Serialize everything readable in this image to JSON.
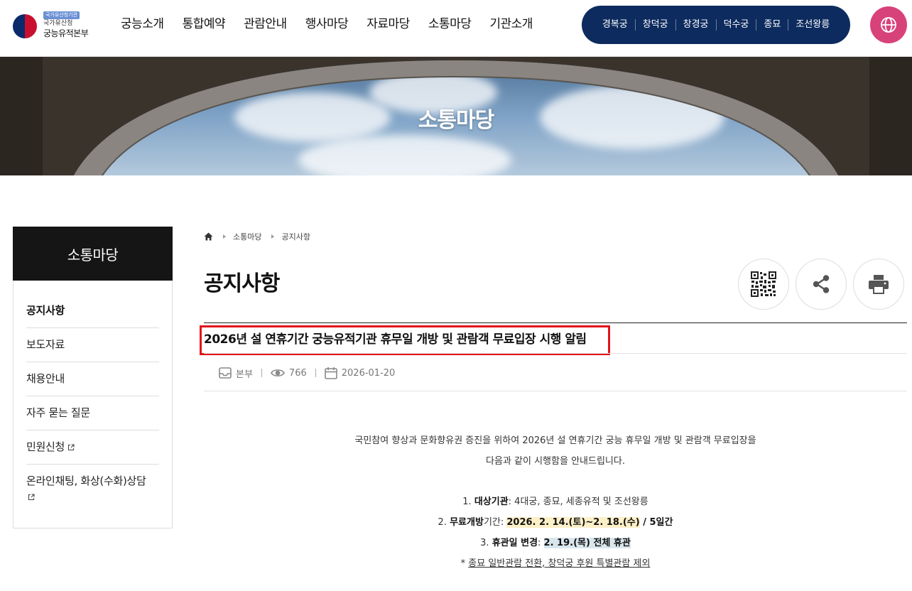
{
  "logo": {
    "badge": "국가유산청기관",
    "sub": "국가유산청",
    "main": "궁능유적본부"
  },
  "gnb": [
    "궁능소개",
    "통합예약",
    "관람안내",
    "행사마당",
    "자료마당",
    "소통마당",
    "기관소개"
  ],
  "palaces": [
    "경복궁",
    "창덕궁",
    "창경궁",
    "덕수궁",
    "종묘",
    "조선왕릉"
  ],
  "banner": {
    "title": "소통마당"
  },
  "sidebar": {
    "title": "소통마당",
    "items": [
      {
        "label": "공지사항"
      },
      {
        "label": "보도자료"
      },
      {
        "label": "채용안내"
      },
      {
        "label": "자주 묻는 질문"
      },
      {
        "label": "민원신청"
      },
      {
        "label": "온라인채팅, 화상(수화)상담"
      }
    ]
  },
  "breadcrumb": [
    "소통마당",
    "공지사항"
  ],
  "page": {
    "title": "공지사항"
  },
  "post": {
    "title": "2026년 설 연휴기간 궁능유적기관 휴무일 개방 및 관람객 무료입장 시행 알림",
    "dept": "본부",
    "views": "766",
    "date": "2026-01-20",
    "intro1": "국민참여 향상과 문화향유권 증진을 위하여 2026년 설 연휴기간 궁능 휴무일 개방 및 관람객 무료입장을",
    "intro2": "다음과 같이 시행함을 안내드립니다.",
    "item1_num": "1.",
    "item1_label": "대상기관",
    "item1_value": ": 4대궁, 종묘, 세종유적 및 조선왕릉",
    "item2_num": "2.",
    "item2_label": "무료개방",
    "item2_rest": "기간: ",
    "item2_hl": "2026. 2. 14.(토)~2. 18.(수)",
    "item2_tail": " / 5일간",
    "item3_num": "3.",
    "item3_label": "휴관일 변경",
    "item3_colon": ": ",
    "item3_hl": "2. 19.(목) 전체 휴관",
    "note_star": "* ",
    "note_text": "종묘 일반관람 전환, 창덕궁 후원 특별관람 제외"
  },
  "colors": {
    "palace_bar": "#0d2b5e",
    "lang_button": "#d8427a",
    "highlight_box": "#e3131a",
    "highlight_yellow": "#fdf0c8",
    "highlight_blue": "#d9e6ee"
  },
  "icons": [
    "home-icon",
    "external-link-icon",
    "qr-code-icon",
    "share-icon",
    "print-icon",
    "globe-icon",
    "inbox-icon",
    "eye-icon",
    "calendar-icon"
  ]
}
